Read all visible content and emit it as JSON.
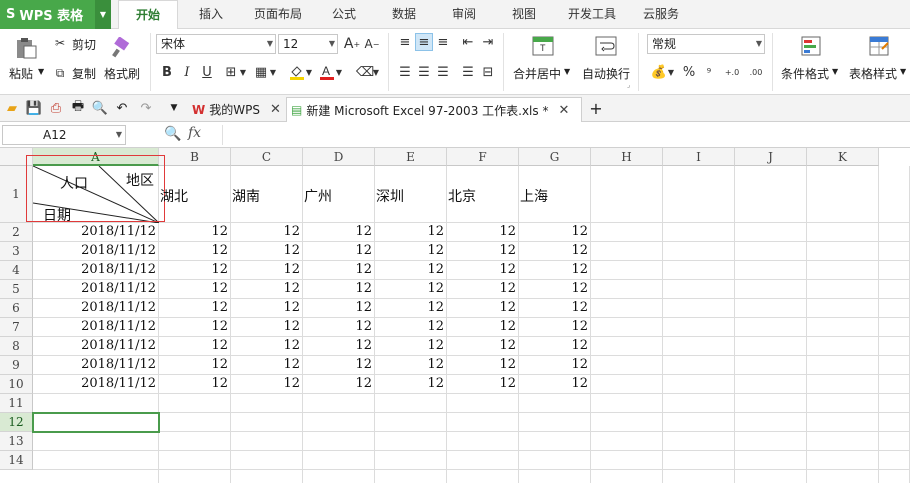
{
  "app": {
    "name": "WPS 表格",
    "logo": "S"
  },
  "menu": {
    "tabs": [
      "开始",
      "插入",
      "页面布局",
      "公式",
      "数据",
      "审阅",
      "视图",
      "开发工具",
      "云服务"
    ],
    "active": "开始"
  },
  "ribbon": {
    "paste": "粘贴",
    "cut": "剪切",
    "copy": "复制",
    "format_painter": "格式刷",
    "font_name": "宋体",
    "font_size": "12",
    "merge_center": "合并居中",
    "wrap_text": "自动换行",
    "number_format": "常规",
    "conditional_format": "条件格式",
    "table_style": "表格样式",
    "percent": "%",
    "comma": "⁹",
    "inc_decimal": "+.0",
    "dec_decimal": ".00"
  },
  "tabs_bar": {
    "my_wps": "我的WPS",
    "document": "新建 Microsoft Excel 97-2003 工作表.xls *"
  },
  "formula_bar": {
    "cell_ref": "A12",
    "fx": "fx",
    "formula": ""
  },
  "sheet": {
    "columns": [
      "A",
      "B",
      "C",
      "D",
      "E",
      "F",
      "G",
      "H",
      "I",
      "J",
      "K"
    ],
    "rows": [
      "1",
      "2",
      "3",
      "4",
      "5",
      "6",
      "7",
      "8",
      "9",
      "10",
      "11",
      "12",
      "13",
      "14"
    ],
    "header_cell": {
      "top_right": "地区",
      "middle": "人口",
      "bottom_left": "日期"
    },
    "regions": [
      "湖北",
      "湖南",
      "广州",
      "深圳",
      "北京",
      "上海"
    ],
    "data_rows": [
      {
        "date": "2018/11/12",
        "values": [
          "12",
          "12",
          "12",
          "12",
          "12",
          "12"
        ]
      },
      {
        "date": "2018/11/12",
        "values": [
          "12",
          "12",
          "12",
          "12",
          "12",
          "12"
        ]
      },
      {
        "date": "2018/11/12",
        "values": [
          "12",
          "12",
          "12",
          "12",
          "12",
          "12"
        ]
      },
      {
        "date": "2018/11/12",
        "values": [
          "12",
          "12",
          "12",
          "12",
          "12",
          "12"
        ]
      },
      {
        "date": "2018/11/12",
        "values": [
          "12",
          "12",
          "12",
          "12",
          "12",
          "12"
        ]
      },
      {
        "date": "2018/11/12",
        "values": [
          "12",
          "12",
          "12",
          "12",
          "12",
          "12"
        ]
      },
      {
        "date": "2018/11/12",
        "values": [
          "12",
          "12",
          "12",
          "12",
          "12",
          "12"
        ]
      },
      {
        "date": "2018/11/12",
        "values": [
          "12",
          "12",
          "12",
          "12",
          "12",
          "12"
        ]
      },
      {
        "date": "2018/11/12",
        "values": [
          "12",
          "12",
          "12",
          "12",
          "12",
          "12"
        ]
      }
    ],
    "selected_cell": "A12",
    "selected_column": "A",
    "selected_row": "12"
  },
  "colors": {
    "accent": "#48a84a",
    "selection": "#4a9b4c",
    "highlight_frame": "#e03a3a"
  }
}
